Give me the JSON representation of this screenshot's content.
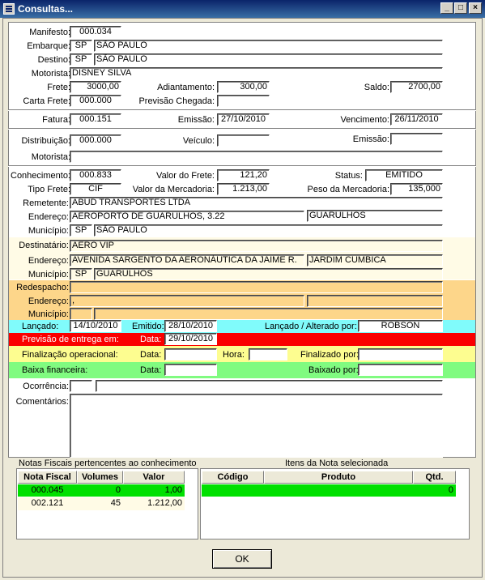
{
  "window": {
    "title": "Consultas...",
    "min": "_",
    "max": "□",
    "close": "×"
  },
  "manifesto": {
    "label": "Manifesto:",
    "value": "000.034"
  },
  "embarque": {
    "label": "Embarque:",
    "uf": "SP",
    "city": "SÃO PAULO"
  },
  "destino": {
    "label": "Destino:",
    "uf": "SP",
    "city": "SÃO PAULO"
  },
  "motorista1": {
    "label": "Motorista:",
    "value": "DISNEY SILVA"
  },
  "frete": {
    "label": "Frete:",
    "value": "3000,00"
  },
  "adiantamento": {
    "label": "Adiantamento:",
    "value": "300,00"
  },
  "saldo": {
    "label": "Saldo:",
    "value": "2700,00"
  },
  "carta_frete": {
    "label": "Carta Frete:",
    "value": "000.000"
  },
  "previsao_chegada": {
    "label": "Previsão Chegada:",
    "value": ""
  },
  "fatura": {
    "label": "Fatura:",
    "value": "000.151"
  },
  "emissao1": {
    "label": "Emissão:",
    "value": "27/10/2010"
  },
  "vencimento": {
    "label": "Vencimento:",
    "value": "26/11/2010"
  },
  "distribuicao": {
    "label": "Distribuição:",
    "value": "000.000"
  },
  "veiculo": {
    "label": "Veículo:",
    "value": ""
  },
  "emissao2": {
    "label": "Emissão:",
    "value": ""
  },
  "motorista2": {
    "label": "Motorista:",
    "value": ""
  },
  "conhecimento": {
    "label": "Conhecimento:",
    "value": "000.833"
  },
  "valor_frete": {
    "label": "Valor do Frete:",
    "value": "121,20"
  },
  "status": {
    "label": "Status:",
    "value": "EMITIDO"
  },
  "tipo_frete": {
    "label": "Tipo Frete:",
    "value": "CIF"
  },
  "valor_mercadoria": {
    "label": "Valor da Mercadoria:",
    "value": "1.213,00"
  },
  "peso_mercadoria": {
    "label": "Peso da Mercadoria:",
    "value": "135,000"
  },
  "remetente": {
    "label": "Remetente:",
    "value": "ABUD TRANSPORTES LTDA",
    "endereco_label": "Endereço:",
    "endereco": "AEROPORTO DE GUARULHOS, 3.22",
    "bairro": "GUARULHOS",
    "municipio_label": "Município:",
    "uf": "SP",
    "cidade": "SÃO PAULO"
  },
  "destinatario": {
    "label": "Destinatário:",
    "value": "AERO VIP",
    "endereco_label": "Endereço:",
    "endereco": "AVENIDA SARGENTO DA AERONÁUTICA DA JAIME R.",
    "bairro": "JARDIM CUMBICA",
    "municipio_label": "Município:",
    "uf": "SP",
    "cidade": "GUARULHOS"
  },
  "redespacho": {
    "label": "Redespacho:",
    "value": "",
    "endereco_label": "Endereço:",
    "endereco": ",",
    "bairro": "",
    "municipio_label": "Município:",
    "uf": "",
    "cidade": ""
  },
  "lancado": {
    "label": "Lançado:",
    "value": "14/10/2010",
    "emitido_label": "Emitido:",
    "emitido": "28/10/2010",
    "alterado_label": "Lançado / Alterado por:",
    "alterado": "ROBSON"
  },
  "previsao_entrega": {
    "label": "Previsão de entrega em:",
    "data_label": "Data:",
    "data": "29/10/2010"
  },
  "finalizacao": {
    "label": "Finalização operacional:",
    "data_label": "Data:",
    "data": "",
    "hora_label": "Hora:",
    "hora": "",
    "por_label": "Finalizado por:",
    "por": ""
  },
  "baixa": {
    "label": "Baixa financeira:",
    "data_label": "Data:",
    "data": "",
    "por_label": "Baixado por:",
    "por": ""
  },
  "ocorrencia": {
    "label": "Ocorrência:",
    "code": "",
    "desc": ""
  },
  "comentarios": {
    "label": "Comentários:",
    "value": ""
  },
  "notas": {
    "title": "Notas Fiscais pertencentes ao conhecimento",
    "headers": [
      "Nota Fiscal",
      "Volumes",
      "Valor"
    ],
    "rows": [
      [
        "000.045",
        "0",
        "1,00"
      ],
      [
        "002.121",
        "45",
        "1.212,00"
      ]
    ]
  },
  "itens": {
    "title": "Itens da Nota selecionada",
    "headers": [
      "Código",
      "Produto",
      "Qtd."
    ],
    "rows": [
      [
        "",
        "",
        "0"
      ]
    ]
  },
  "ok_label": "OK",
  "colors": {
    "cream": "#fffbe6",
    "orange": "#fdd68a",
    "cyan": "#80fbfb",
    "red": "#fa0000",
    "yellow": "#fdfd90",
    "green": "#80fb80",
    "selected": "#00e000"
  }
}
